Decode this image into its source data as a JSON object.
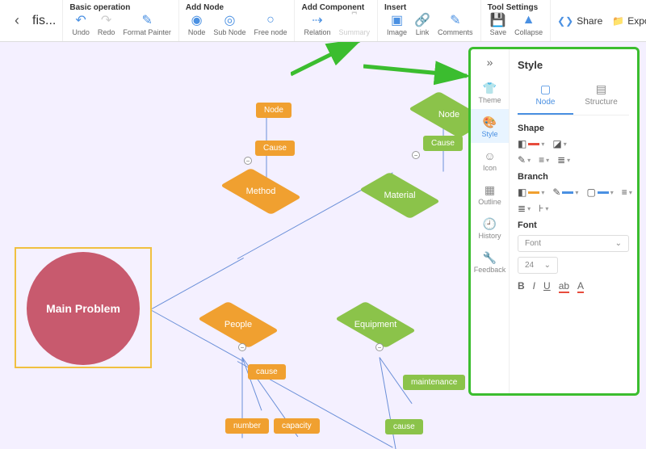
{
  "header": {
    "filename": "fis...",
    "groups": {
      "basic": {
        "label": "Basic operation",
        "undo": "Undo",
        "redo": "Redo",
        "format": "Format Painter"
      },
      "addNode": {
        "label": "Add Node",
        "node": "Node",
        "sub": "Sub Node",
        "free": "Free node"
      },
      "addComp": {
        "label": "Add Component",
        "relation": "Relation",
        "summary": "Summary"
      },
      "insert": {
        "label": "Insert",
        "image": "Image",
        "link": "Link",
        "comments": "Comments"
      },
      "tool": {
        "label": "Tool Settings",
        "save": "Save",
        "collapse": "Collapse"
      }
    },
    "share": "Share",
    "export": "Export"
  },
  "canvas": {
    "main": "Main Problem",
    "method": "Method",
    "material": "Material",
    "people": "People",
    "equipment": "Equipment",
    "node": "Node",
    "cause": "Cause",
    "causeLower": "cause",
    "number": "number",
    "capacity": "capacity",
    "maintenance": "maintenance"
  },
  "panel": {
    "title": "Style",
    "sideTabs": {
      "theme": "Theme",
      "style": "Style",
      "icon": "Icon",
      "outline": "Outline",
      "history": "History",
      "feedback": "Feedback"
    },
    "topTabs": {
      "node": "Node",
      "structure": "Structure"
    },
    "sections": {
      "shape": "Shape",
      "branch": "Branch",
      "font": "Font"
    },
    "fontSelect": "Font",
    "fontSize": "24",
    "fontBtns": {
      "b": "B",
      "i": "I",
      "u": "U",
      "ab": "ab",
      "a": "A"
    }
  },
  "colors": {
    "blue": "#4a90e2",
    "orange": "#f0a030",
    "red": "#e74c3c"
  }
}
